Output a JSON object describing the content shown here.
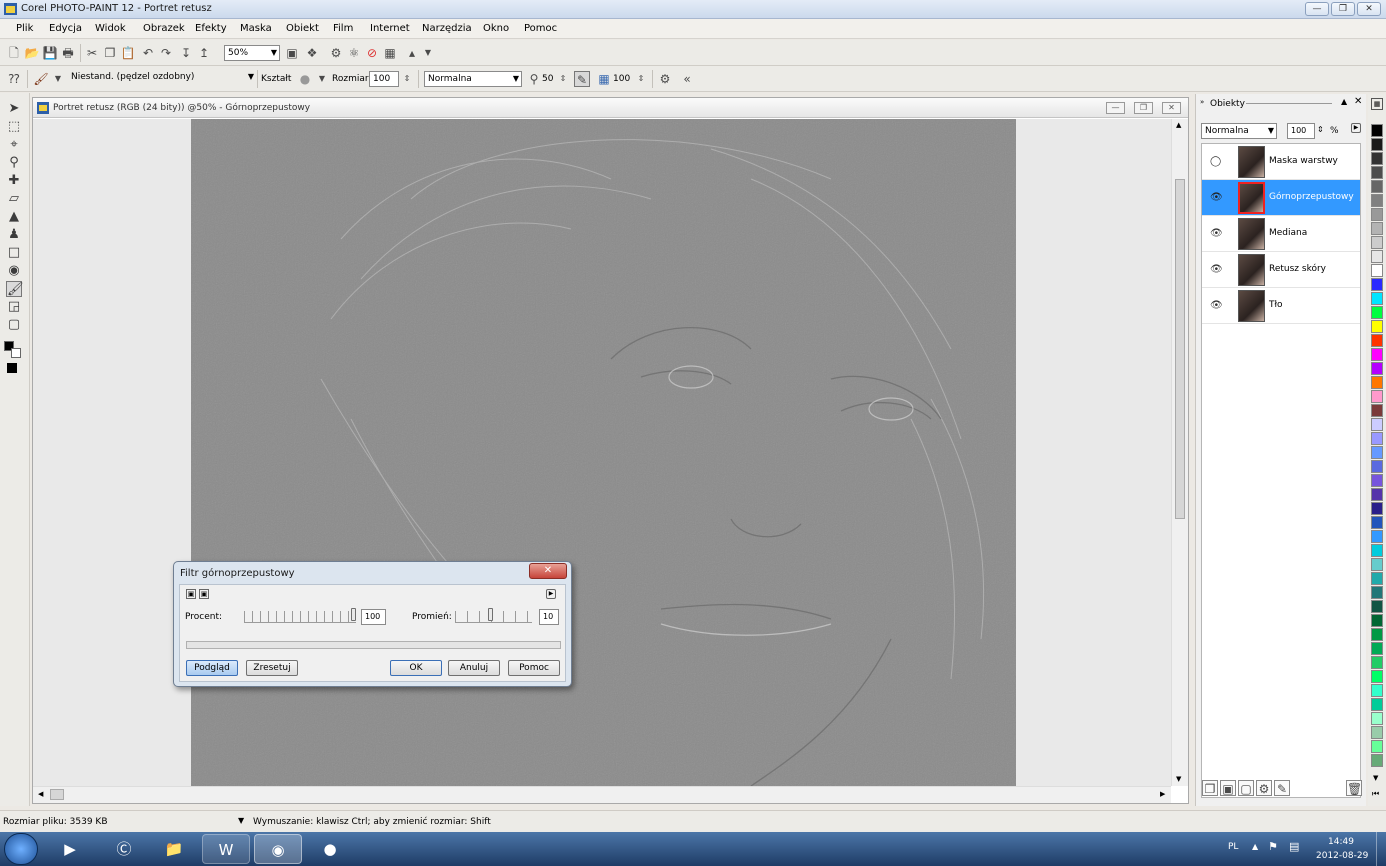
{
  "app": {
    "title": "Corel PHOTO-PAINT 12 - Portret retusz"
  },
  "menu": [
    "Plik",
    "Edycja",
    "Widok",
    "Obrazek",
    "Efekty",
    "Maska",
    "Obiekt",
    "Film",
    "Internet",
    "Narzędzia",
    "Okno",
    "Pomoc"
  ],
  "toolbar": {
    "zoom": "50%"
  },
  "propbar": {
    "brush_type": "Niestand. (pędzel ozdobny)",
    "shape_label": "Kształt",
    "size_label": "Rozmiar",
    "size_value": "100",
    "blend_mode": "Normalna",
    "transparency_value": "50",
    "opacity_value": "100"
  },
  "document": {
    "title": "Portret retusz (RGB (24 bity)) @50% - Górnoprzepustowy"
  },
  "dialog": {
    "title": "Filtr górnoprzepustowy",
    "percent_label": "Procent:",
    "percent_value": "100",
    "radius_label": "Promień:",
    "radius_value": "10",
    "preview_button": "Podgląd",
    "reset_button": "Zresetuj",
    "ok_button": "OK",
    "cancel_button": "Anuluj",
    "help_button": "Pomoc"
  },
  "objects_panel": {
    "title": "Obiekty",
    "blend_mode": "Normalna",
    "opacity": "100",
    "opacity_unit": "%",
    "layers": [
      {
        "name": "Maska warstwy",
        "selected": false
      },
      {
        "name": "Górnoprzepustowy",
        "selected": true
      },
      {
        "name": "Mediana",
        "selected": false
      },
      {
        "name": "Retusz skóry",
        "selected": false
      },
      {
        "name": "Tło",
        "selected": false
      }
    ]
  },
  "palette_colors": [
    "#000000",
    "#1a1a1a",
    "#333333",
    "#4d4d4d",
    "#666666",
    "#808080",
    "#999999",
    "#b3b3b3",
    "#cccccc",
    "#e6e6e6",
    "#ffffff",
    "#2a2aff",
    "#00e5ff",
    "#00ff40",
    "#ffff00",
    "#ff3300",
    "#ff00ff",
    "#b400ff",
    "#ff7700",
    "#ff99cc",
    "#7a3a3a",
    "#ccccff",
    "#9999ff",
    "#6699ff",
    "#5a6adf",
    "#7755dd",
    "#5533aa",
    "#2a1f8a",
    "#2255bb",
    "#3399ff",
    "#00ccdd",
    "#66cccc",
    "#22aaaa",
    "#227777",
    "#115544",
    "#006633",
    "#009944",
    "#00aa55",
    "#22cc66",
    "#00ff66",
    "#33ffcc",
    "#00cc99",
    "#99ffcc",
    "#99ccaa",
    "#66ff99",
    "#66aa77"
  ],
  "status": {
    "file_size": "Rozmiar pliku: 3539 KB",
    "hint": "Wymuszanie: klawisz Ctrl; aby zmienić rozmiar: Shift"
  },
  "taskbar": {
    "language": "PL",
    "time": "14:49",
    "date": "2012-08-29"
  }
}
